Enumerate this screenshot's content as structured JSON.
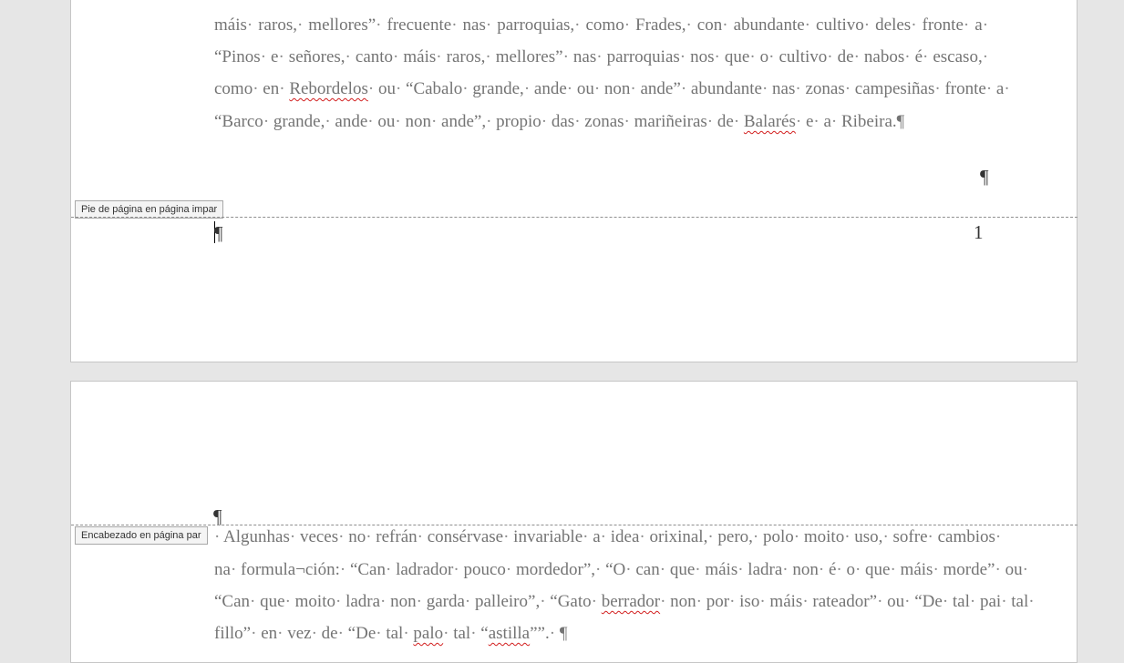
{
  "page1": {
    "body_lines": [
      "máis·raros,·mellores”·frecuente·nas·parroquias,·como·Frades,·con·abundante·cultivo·deles·fronte·a·",
      "“Pinos·e·señores,·canto·máis·raros,·mellores”·nas·parroquias·nos·que·o·cultivo·de·nabos·é·escaso,·",
      "como·en·Rebordelos·ou·“Cabalo·grande,·ande·ou·non·ande”·abundante·nas·zonas·campesiñas·fronte·a·",
      "“Barco·grande,·ande·ou·non·ande”,·propio·das·zonas·mariñeiras·de·Balarés·e·a·Ribeira.¶"
    ],
    "top_cut_line": "¶",
    "end_mark": "¶",
    "footer_label": "Pie de página en página impar",
    "footer_mark": "¶",
    "page_number": "1"
  },
  "page2": {
    "header_label": "Encabezado en página par",
    "header_mark": "¶",
    "body_lines": [
      "·Algunhas·veces·no·refrán·consérvase·invariable·a·idea·orixinal,·pero,·polo·moito·uso,·sofre·cambios·",
      "na·formula¬ción:·“Can·ladrador·pouco·mordedor”,·“O·can·que·máis·ladra·non·é·o·que·máis·morde”·ou·",
      "“Can·que·moito·ladra·non·garda·palleiro”,·“Gato·berrador·non·por·iso·máis·rateador”·ou·“De·tal·pai·tal·",
      "fillo”·en·vez·de·“De·tal·palo·tal·“astilla””.·¶"
    ]
  },
  "misspelled": [
    "Rebordelos",
    "Balarés",
    "berrador",
    "palo",
    "astilla"
  ]
}
